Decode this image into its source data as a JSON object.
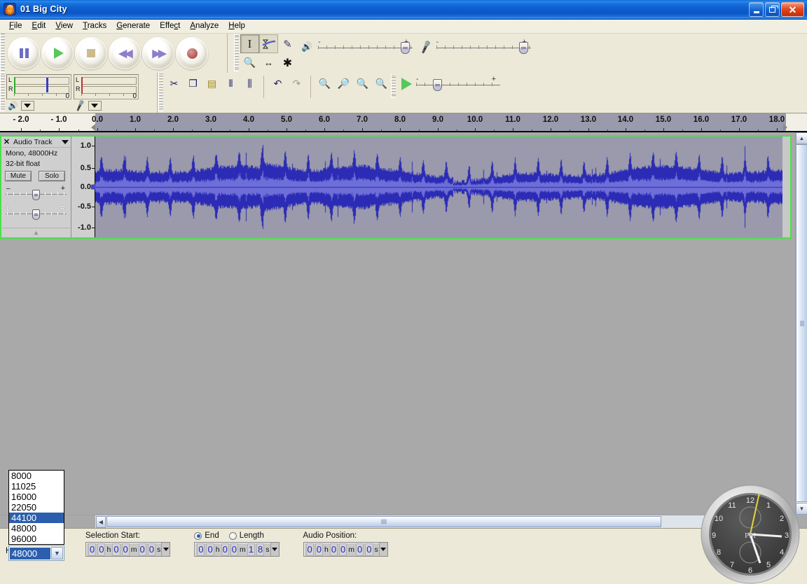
{
  "window": {
    "title": "01 Big City",
    "icon": "audacity-logo-icon",
    "minimize_label": "",
    "restore_label": "",
    "close_label": "✕"
  },
  "menubar": {
    "items": [
      {
        "label": "File",
        "accel": "F"
      },
      {
        "label": "Edit",
        "accel": "E"
      },
      {
        "label": "View",
        "accel": "V"
      },
      {
        "label": "Tracks",
        "accel": "T"
      },
      {
        "label": "Generate",
        "accel": "G"
      },
      {
        "label": "Effect",
        "accel": "c"
      },
      {
        "label": "Analyze",
        "accel": "A"
      },
      {
        "label": "Help",
        "accel": "H"
      }
    ]
  },
  "transport": {
    "buttons": [
      {
        "name": "pause-button",
        "label": "Pause"
      },
      {
        "name": "play-button",
        "label": "Play"
      },
      {
        "name": "stop-button",
        "label": "Stop"
      },
      {
        "name": "skip-to-start-button",
        "label": "Skip to Start"
      },
      {
        "name": "skip-to-end-button",
        "label": "Skip to End"
      },
      {
        "name": "record-button",
        "label": "Record"
      }
    ]
  },
  "tools": {
    "buttons": [
      {
        "name": "selection-tool",
        "label": "Selection Tool",
        "selected": true
      },
      {
        "name": "envelope-tool",
        "label": "Envelope Tool",
        "selected": false
      },
      {
        "name": "draw-tool",
        "label": "Draw Tool",
        "selected": false
      },
      {
        "name": "zoom-tool",
        "label": "Zoom Tool",
        "selected": false
      },
      {
        "name": "timeshift-tool",
        "label": "Time Shift Tool",
        "selected": false
      },
      {
        "name": "multi-tool",
        "label": "Multi Tool",
        "selected": false
      }
    ]
  },
  "mixer": {
    "output_icon": "speaker-icon",
    "output_minus": "-",
    "output_plus": "+",
    "input_icon": "microphone-icon",
    "input_minus": "-",
    "input_plus": "+"
  },
  "meters": {
    "output": {
      "left": "L",
      "right": "R",
      "max": "0"
    },
    "input": {
      "left": "L",
      "right": "R",
      "max": "0"
    },
    "output_icon": "speaker-icon",
    "input_icon": "microphone-icon"
  },
  "edit_toolbar": {
    "buttons": [
      {
        "name": "cut-button",
        "label": "Cut",
        "glyph": "✂"
      },
      {
        "name": "copy-button",
        "label": "Copy",
        "glyph": "❐"
      },
      {
        "name": "paste-button",
        "label": "Paste",
        "glyph": "📋"
      },
      {
        "name": "trim-outside-button",
        "label": "Trim outside selection",
        "glyph": "⦀"
      },
      {
        "name": "silence-selection-button",
        "label": "Silence selection",
        "glyph": "⫼"
      },
      {
        "name": "undo-button",
        "label": "Undo",
        "glyph": "↶"
      },
      {
        "name": "redo-button",
        "label": "Redo",
        "glyph": "↷"
      },
      {
        "name": "zoom-in-button",
        "label": "Zoom In",
        "glyph": "+"
      },
      {
        "name": "zoom-out-button",
        "label": "Zoom Out",
        "glyph": "−"
      },
      {
        "name": "fit-selection-button",
        "label": "Fit selection in window",
        "glyph": "↔"
      },
      {
        "name": "fit-project-button",
        "label": "Fit project in window",
        "glyph": "⟷"
      },
      {
        "name": "play-at-speed-button",
        "label": "Play-at-Speed",
        "glyph": "▶"
      }
    ],
    "speed_minus": "-",
    "speed_plus": "+"
  },
  "ruler": {
    "unit": "seconds",
    "labels": [
      "- 2.0",
      "- 1.0",
      "0.0",
      "1.0",
      "2.0",
      "3.0",
      "4.0",
      "5.0",
      "6.0",
      "7.0",
      "8.0",
      "9.0",
      "10.0",
      "11.0",
      "12.0",
      "13.0",
      "14.0",
      "15.0",
      "16.0",
      "17.0",
      "18.0"
    ],
    "positions": [
      30,
      84,
      139,
      193,
      247,
      301,
      355,
      409,
      463,
      517,
      571,
      625,
      678,
      732,
      786,
      840,
      893,
      947,
      1001,
      1055,
      1109
    ]
  },
  "track": {
    "close_label": "✕",
    "name": "Audio Track",
    "info_line1": "Mono, 48000Hz",
    "info_line2": "32-bit float",
    "mute_label": "Mute",
    "solo_label": "Solo",
    "gain_minus": "–",
    "gain_plus": "+",
    "pan_left": "L",
    "pan_right": "R",
    "vertical_ruler": [
      "1.0",
      "0.5",
      "0.0",
      "-0.5",
      "-1.0"
    ],
    "resize_handle": "▵"
  },
  "status": {
    "rate_label": "Hz):",
    "selection_start_label": "Selection Start:",
    "end_label": "End",
    "length_label": "Length",
    "end_selected": true,
    "audio_position_label": "Audio Position:",
    "selection_start": {
      "h": [
        "0",
        "0"
      ],
      "m": [
        "0",
        "0"
      ],
      "s": [
        "0",
        "0"
      ],
      "hu": "h",
      "mu": "m",
      "su": "s"
    },
    "selection_end": {
      "h": [
        "0",
        "0"
      ],
      "m": [
        "0",
        "0"
      ],
      "s": [
        "1",
        "8"
      ],
      "hu": "h",
      "mu": "m",
      "su": "s"
    },
    "audio_position": {
      "h": [
        "0",
        "0"
      ],
      "m": [
        "0",
        "0"
      ],
      "s": [
        "0",
        "0"
      ],
      "hu": "h",
      "mu": "m",
      "su": "s"
    }
  },
  "rate_combo": {
    "value": "48000",
    "expanded": true,
    "options": [
      "8000",
      "11025",
      "16000",
      "22050",
      "44100",
      "48000",
      "96000"
    ],
    "highlighted": "44100"
  },
  "clock_gadget": {
    "name": "desktop-clock-gadget",
    "meridiem": "PM",
    "hour_numerals": [
      "12",
      "1",
      "2",
      "3",
      "4",
      "5",
      "6",
      "7",
      "8",
      "9",
      "10",
      "11"
    ]
  },
  "colors": {
    "titlebar_blue": "#0a56c6",
    "selection_border_green": "#49e049",
    "waveform_blue": "#2b2bb5",
    "waveform_rms": "#6e6ed8",
    "selected_background": "#9a9aac",
    "toolbar_face": "#ece9d8",
    "highlight_blue": "#2b5fad"
  }
}
